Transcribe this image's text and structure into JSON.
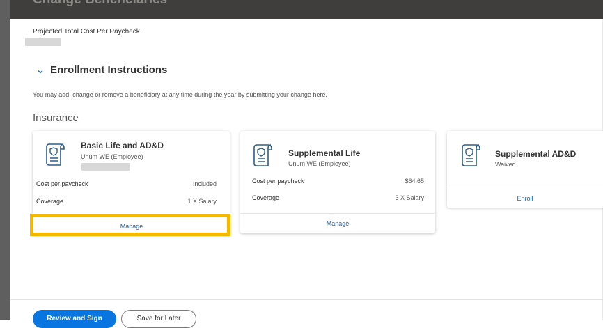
{
  "header": {
    "title": "Change Beneficiaries"
  },
  "projected": {
    "label": "Projected Total Cost Per Paycheck"
  },
  "enrollment": {
    "section_title": "Enrollment Instructions",
    "instructions": "You may add, change or remove a beneficiary at any time during the year by submitting your change here."
  },
  "insurance": {
    "title": "Insurance"
  },
  "cards": [
    {
      "title": "Basic Life and AD&D",
      "subtitle": "Unum WE (Employee)",
      "rows": [
        {
          "label": "Cost per paycheck",
          "value": "Included"
        },
        {
          "label": "Coverage",
          "value": "1 X Salary"
        }
      ],
      "action": "Manage"
    },
    {
      "title": "Supplemental Life",
      "subtitle": "Unum WE (Employee)",
      "rows": [
        {
          "label": "Cost per paycheck",
          "value": "$64.65"
        },
        {
          "label": "Coverage",
          "value": "3 X Salary"
        }
      ],
      "action": "Manage"
    },
    {
      "title": "Supplemental AD&D",
      "subtitle": "Waived",
      "action": "Enroll"
    }
  ],
  "footer": {
    "primary": "Review and Sign",
    "secondary": "Save for Later"
  },
  "colors": {
    "highlight": "#f5b800",
    "primary_button": "#0875e1",
    "link": "#1f5ea8",
    "icon": "#2b5f8a"
  },
  "icons": {
    "card_icon": "insurance-document-icon",
    "chevron": "chevron-down-icon"
  }
}
